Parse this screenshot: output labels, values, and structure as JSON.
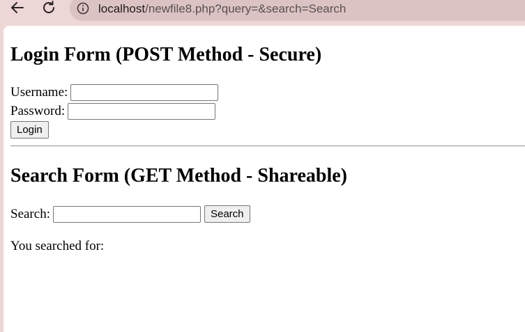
{
  "browser": {
    "url_host": "localhost",
    "url_rest": "/newfile8.php?query=&search=Search"
  },
  "login": {
    "title": "Login Form (POST Method - Secure)",
    "username_label": "Username:",
    "username_value": "",
    "password_label": "Password:",
    "password_value": "",
    "submit_label": "Login"
  },
  "search": {
    "title": "Search Form (GET Method - Shareable)",
    "search_label": "Search:",
    "search_value": "",
    "submit_label": "Search",
    "result_text": "You searched for:"
  }
}
